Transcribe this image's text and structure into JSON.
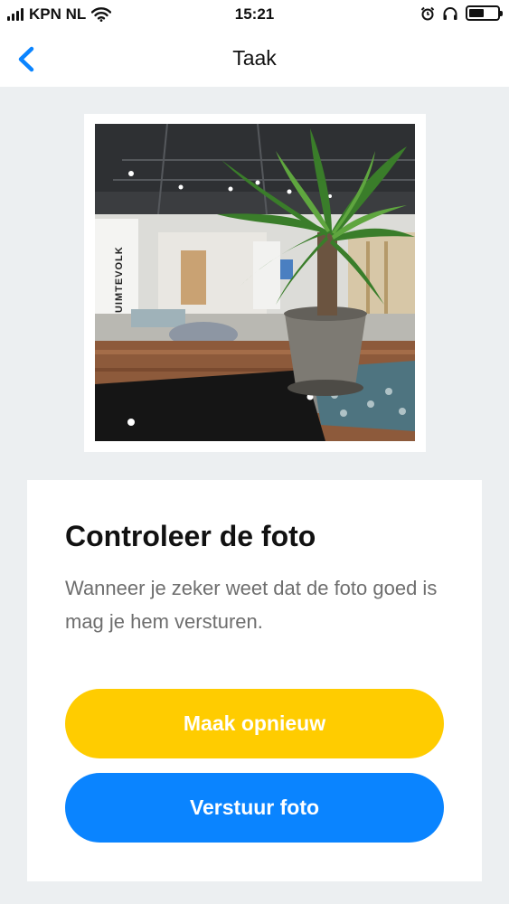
{
  "status_bar": {
    "carrier": "KPN NL",
    "time": "15:21",
    "icons": [
      "signal-icon",
      "wifi-icon",
      "alarm-icon",
      "headphones-icon",
      "battery-icon"
    ],
    "battery_level": 0.4
  },
  "nav": {
    "back_icon": "chevron-left-icon",
    "title": "Taak"
  },
  "photo": {
    "sign_text": "RUIMTEVOLK"
  },
  "card": {
    "title": "Controleer de foto",
    "description": "Wanneer je zeker weet dat de foto goed is mag je hem versturen.",
    "retake_label": "Maak opnieuw",
    "send_label": "Verstuur foto"
  },
  "colors": {
    "accent_blue": "#0a84ff",
    "accent_yellow": "#ffcc00",
    "background": "#eceff1",
    "text_secondary": "#6e6e6e"
  }
}
